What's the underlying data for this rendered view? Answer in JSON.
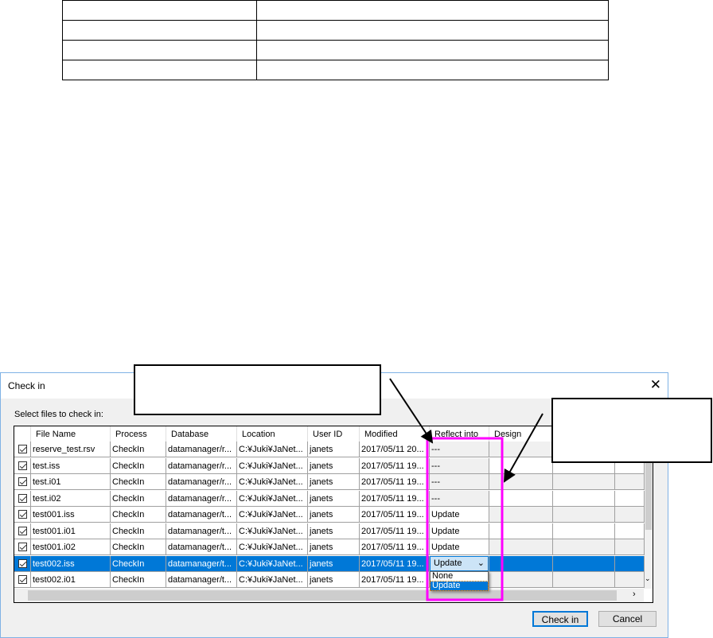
{
  "dialog": {
    "title": "Check in",
    "prompt": "Select files to check in:",
    "check_in_label": "Check in",
    "cancel_label": "Cancel"
  },
  "columns": [
    "",
    "File Name",
    "Process",
    "Database",
    "Location",
    "User ID",
    "Modified",
    "Reflect into",
    "Design",
    "",
    ""
  ],
  "rows": [
    {
      "file": "reserve_test.rsv",
      "process": "CheckIn",
      "database": "datamanager/r...",
      "location": "C:¥Juki¥JaNet...",
      "user": "janets",
      "modified": "2017/05/11 20...",
      "reflect": "---"
    },
    {
      "file": "test.iss",
      "process": "CheckIn",
      "database": "datamanager/r...",
      "location": "C:¥Juki¥JaNet...",
      "user": "janets",
      "modified": "2017/05/11 19...",
      "reflect": "---"
    },
    {
      "file": "test.i01",
      "process": "CheckIn",
      "database": "datamanager/r...",
      "location": "C:¥Juki¥JaNet...",
      "user": "janets",
      "modified": "2017/05/11 19...",
      "reflect": "---"
    },
    {
      "file": "test.i02",
      "process": "CheckIn",
      "database": "datamanager/r...",
      "location": "C:¥Juki¥JaNet...",
      "user": "janets",
      "modified": "2017/05/11 19...",
      "reflect": "---"
    },
    {
      "file": "test001.iss",
      "process": "CheckIn",
      "database": "datamanager/t...",
      "location": "C:¥Juki¥JaNet...",
      "user": "janets",
      "modified": "2017/05/11 19...",
      "reflect": "Update"
    },
    {
      "file": "test001.i01",
      "process": "CheckIn",
      "database": "datamanager/t...",
      "location": "C:¥Juki¥JaNet...",
      "user": "janets",
      "modified": "2017/05/11 19...",
      "reflect": "Update"
    },
    {
      "file": "test001.i02",
      "process": "CheckIn",
      "database": "datamanager/t...",
      "location": "C:¥Juki¥JaNet...",
      "user": "janets",
      "modified": "2017/05/11 19...",
      "reflect": "Update"
    },
    {
      "file": "test002.iss",
      "process": "CheckIn",
      "database": "datamanager/t...",
      "location": "C:¥Juki¥JaNet...",
      "user": "janets",
      "modified": "2017/05/11 19...",
      "reflect": "Update"
    },
    {
      "file": "test002.i01",
      "process": "CheckIn",
      "database": "datamanager/t...",
      "location": "C:¥Juki¥JaNet...",
      "user": "janets",
      "modified": "2017/05/11 19...",
      "reflect": ""
    }
  ],
  "dropdown": {
    "selected": "Update",
    "options": [
      "None",
      "Update"
    ]
  },
  "colors": {
    "selection": "#0078d7",
    "highlight": "#ff00ff"
  }
}
